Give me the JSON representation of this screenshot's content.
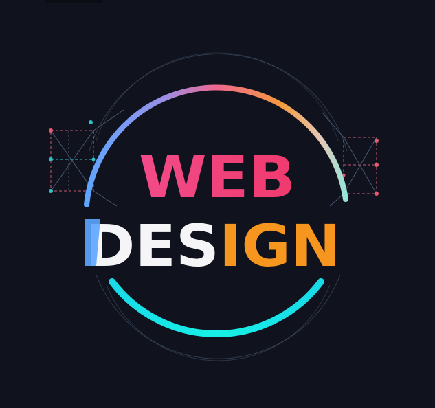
{
  "logo": {
    "line1": "WEB",
    "line2_part1": "DES",
    "line2_part2": "IGN"
  },
  "colors": {
    "background": "#10131d",
    "web_text": "#ee3d7d",
    "design_light": "#f5f5f7",
    "design_orange": "#f6961e",
    "ring_top_blue": "#7fa2f0",
    "ring_top_pink": "#f0678f",
    "ring_top_orange": "#f49a3e",
    "ring_bottom_cyan": "#17e6e2",
    "wire_cyan": "#2bc4cc",
    "wire_pink": "#e85a6e"
  },
  "icons": [
    "wireframe-left-icon",
    "wireframe-right-icon"
  ]
}
